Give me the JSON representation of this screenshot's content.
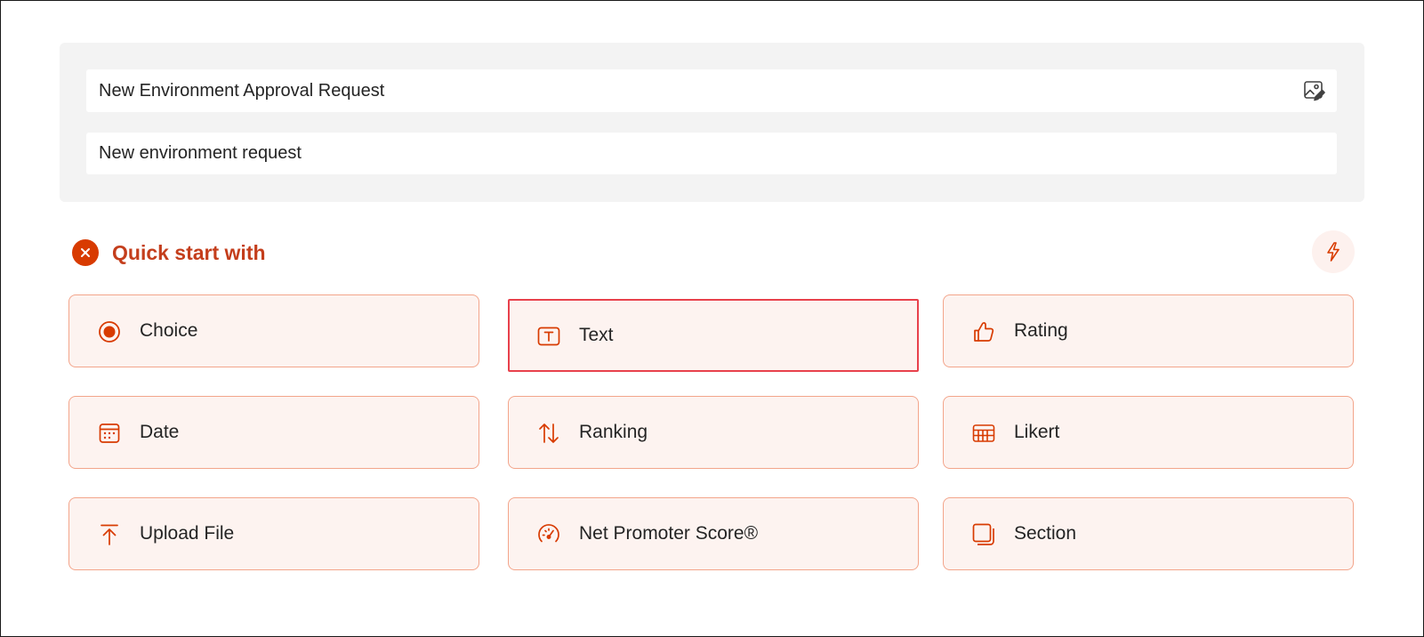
{
  "header": {
    "form_title": "New Environment Approval Request",
    "form_description": "New environment request",
    "image_icon": "image-edit-icon"
  },
  "quick_start": {
    "title": "Quick start with",
    "close_icon": "close-icon",
    "lightning_icon": "lightning-icon"
  },
  "colors": {
    "accent": "#d83b01",
    "accent_text": "#c43e1c",
    "tile_background": "#fdf3f0",
    "tile_border": "#f3a58b",
    "selection_border": "#e8414c",
    "header_background": "#f3f3f3"
  },
  "question_types": [
    {
      "label": "Choice",
      "icon": "radio-icon",
      "selected": false
    },
    {
      "label": "Text",
      "icon": "text-box-icon",
      "selected": true
    },
    {
      "label": "Rating",
      "icon": "thumbs-up-icon",
      "selected": false
    },
    {
      "label": "Date",
      "icon": "calendar-icon",
      "selected": false
    },
    {
      "label": "Ranking",
      "icon": "arrow-sort-icon",
      "selected": false
    },
    {
      "label": "Likert",
      "icon": "likert-grid-icon",
      "selected": false
    },
    {
      "label": "Upload File",
      "icon": "upload-icon",
      "selected": false
    },
    {
      "label": "Net Promoter Score®",
      "icon": "gauge-icon",
      "selected": false
    },
    {
      "label": "Section",
      "icon": "section-icon",
      "selected": false
    }
  ]
}
